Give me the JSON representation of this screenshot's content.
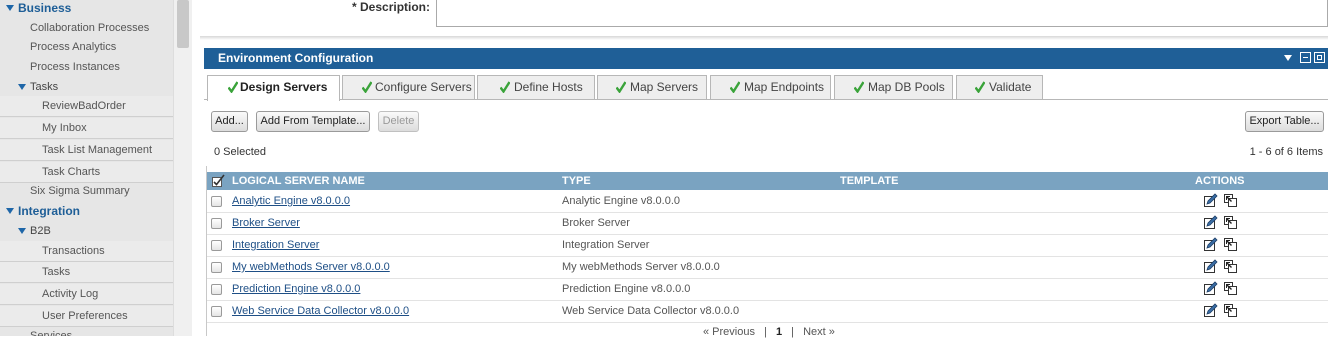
{
  "sidebar": {
    "business": "Business",
    "collaboration_processes": "Collaboration Processes",
    "process_analytics": "Process Analytics",
    "process_instances": "Process Instances",
    "tasks": "Tasks",
    "review_bad_order": "ReviewBadOrder",
    "my_inbox": "My Inbox",
    "task_list_management": "Task List Management",
    "task_charts": "Task Charts",
    "six_sigma_summary": "Six Sigma Summary",
    "integration": "Integration",
    "b2b": "B2B",
    "transactions": "Transactions",
    "b2b_tasks": "Tasks",
    "activity_log": "Activity Log",
    "user_preferences": "User Preferences",
    "services": "Services"
  },
  "form": {
    "description_label": "* Description:",
    "description_value": ""
  },
  "panel": {
    "title": "Environment Configuration"
  },
  "tabs": [
    {
      "label": "Design Servers",
      "active": true
    },
    {
      "label": "Configure Servers",
      "active": false
    },
    {
      "label": "Define Hosts",
      "active": false
    },
    {
      "label": "Map Servers",
      "active": false
    },
    {
      "label": "Map Endpoints",
      "active": false
    },
    {
      "label": "Map DB Pools",
      "active": false
    },
    {
      "label": "Validate",
      "active": false
    }
  ],
  "toolbar": {
    "add": "Add...",
    "add_from_template": "Add From Template...",
    "delete": "Delete",
    "export_table": "Export Table...",
    "selected_count": "0 Selected",
    "items_range": "1 - 6 of 6 Items"
  },
  "table": {
    "columns": {
      "name": "LOGICAL SERVER NAME",
      "type": "TYPE",
      "template": "TEMPLATE",
      "actions": "ACTIONS"
    },
    "rows": [
      {
        "name": "Analytic Engine v8.0.0.0",
        "type": "Analytic Engine v8.0.0.0",
        "template": ""
      },
      {
        "name": "Broker Server",
        "type": "Broker Server",
        "template": ""
      },
      {
        "name": "Integration Server",
        "type": "Integration Server",
        "template": ""
      },
      {
        "name": "My webMethods Server v8.0.0.0",
        "type": "My webMethods Server v8.0.0.0",
        "template": ""
      },
      {
        "name": "Prediction Engine v8.0.0.0",
        "type": "Prediction Engine v8.0.0.0",
        "template": ""
      },
      {
        "name": "Web Service Data Collector v8.0.0.0",
        "type": "Web Service Data Collector v8.0.0.0",
        "template": ""
      }
    ]
  },
  "pager": {
    "previous": "« Previous",
    "sep1": "|",
    "current": "1",
    "sep2": "|",
    "next": "Next »"
  },
  "colors": {
    "panel_header": "#1f5f97",
    "table_header": "#7aa3c1",
    "link": "#1e4f86",
    "check_green": "#3aa33a"
  },
  "icons": {
    "tab_status": "check-icon",
    "row_action_1": "edit-icon",
    "row_action_2": "copy-icon"
  }
}
